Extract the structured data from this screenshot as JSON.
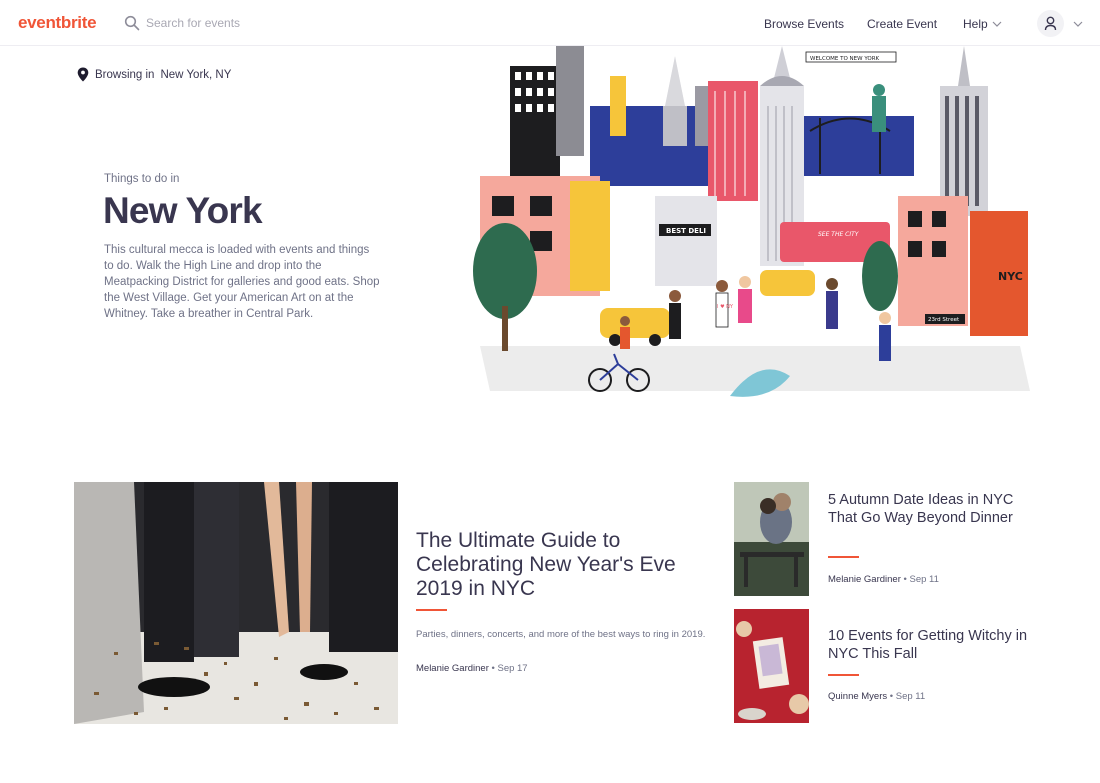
{
  "header": {
    "logo": "eventbrite",
    "search_placeholder": "Search for events",
    "nav": {
      "browse": "Browse Events",
      "create": "Create Event",
      "help": "Help"
    }
  },
  "hero": {
    "browsing_label": "Browsing in",
    "browsing_city": "New York, NY",
    "kicker": "Things to do in",
    "title": "New York",
    "description": "This cultural mecca is loaded with events and things to do. Walk the High Line and drop into the Meatpacking District for galleries and good eats. Shop the West Village. Get your American Art on at the Whitney. Take a breather in Central Park.",
    "illustration": {
      "banner": "WELCOME TO NEW YORK",
      "deli_sign": "BEST DELI",
      "bus_sign": "SEE THE CITY",
      "street_sign": "23rd Street",
      "nyc_sign": "NYC",
      "shirt_text": "I ♥ NY"
    }
  },
  "articles": {
    "feature": {
      "title": "The Ultimate Guide to Celebrating New Year's Eve 2019 in NYC",
      "description": "Parties, dinners, concerts, and more of the best ways to ring in 2019.",
      "author": "Melanie Gardiner",
      "date": "• Sep 17"
    },
    "side": [
      {
        "title": "5 Autumn Date Ideas in NYC That Go Way Beyond Dinner",
        "author": "Melanie Gardiner",
        "date": "• Sep 11"
      },
      {
        "title": "10 Events for Getting Witchy in NYC This Fall",
        "author": "Quinne Myers",
        "date": "• Sep 11"
      }
    ]
  },
  "colors": {
    "brand": "#f05537",
    "text_dark": "#39364f",
    "text_muted": "#6f7287"
  },
  "icons": [
    "search-icon",
    "chevron-down-icon",
    "user-icon",
    "map-pin-icon"
  ]
}
